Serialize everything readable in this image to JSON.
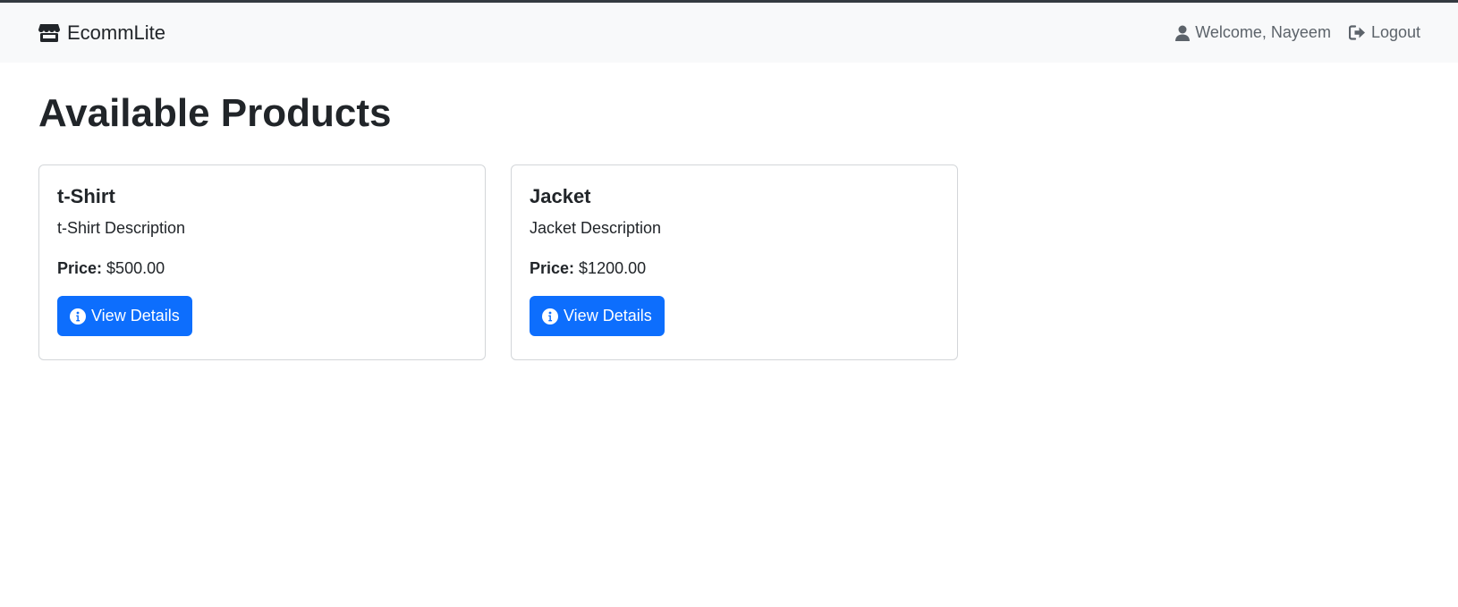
{
  "navbar": {
    "brand": "EcommLite",
    "welcome": "Welcome, Nayeem",
    "logout": "Logout",
    "brand_icon": "store-icon",
    "user_icon": "user-icon",
    "logout_icon": "logout-icon"
  },
  "main": {
    "title": "Available Products",
    "price_label": "Price:",
    "products": [
      {
        "name": "t-Shirt",
        "description": "t-Shirt Description",
        "price": "$500.00",
        "button": "View Details"
      },
      {
        "name": "Jacket",
        "description": "Jacket Description",
        "price": "$1200.00",
        "button": "View Details"
      }
    ]
  },
  "colors": {
    "primary": "#0d6efd",
    "navbar_bg": "#f8f9fa",
    "text": "#212529",
    "muted": "#5c636a"
  }
}
